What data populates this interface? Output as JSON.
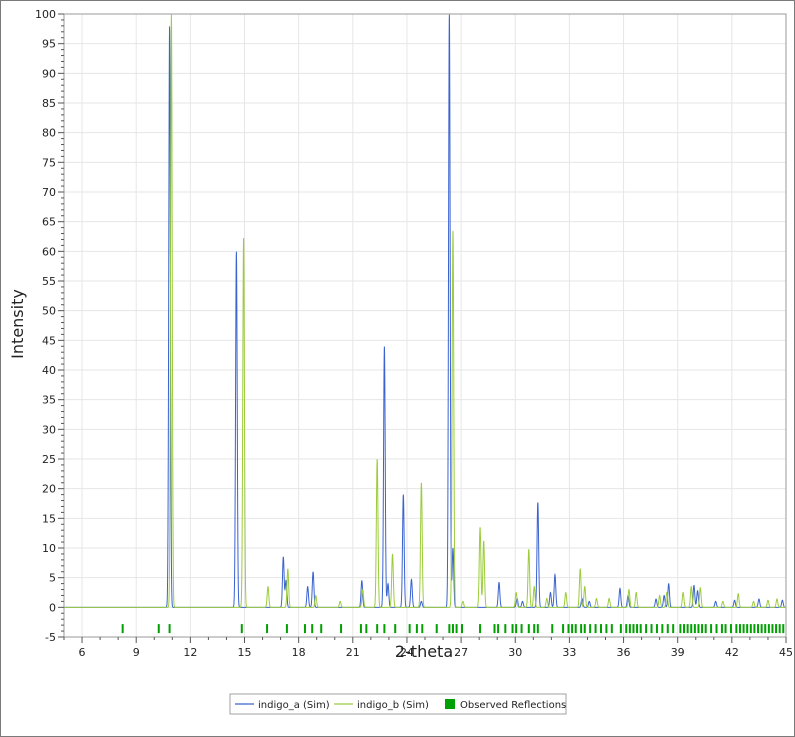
{
  "chart_data": {
    "type": "line",
    "xlabel": "2-theta",
    "ylabel": "Intensity",
    "xlim": [
      5,
      45
    ],
    "ylim": [
      -5,
      100
    ],
    "xticks": [
      6,
      9,
      12,
      15,
      18,
      21,
      24,
      27,
      30,
      33,
      36,
      39,
      42,
      45
    ],
    "yticks": [
      -5,
      0,
      5,
      10,
      15,
      20,
      25,
      30,
      35,
      40,
      45,
      50,
      55,
      60,
      65,
      70,
      75,
      80,
      85,
      90,
      95,
      100
    ],
    "grid": true,
    "legend_position": "bottom-center",
    "series": [
      {
        "name": "indigo_a (Sim)",
        "type": "line",
        "color": "#3a63d0",
        "peaks": [
          [
            10.85,
            98
          ],
          [
            14.55,
            60
          ],
          [
            17.15,
            8.5
          ],
          [
            17.3,
            4.5
          ],
          [
            18.5,
            3.5
          ],
          [
            18.8,
            6
          ],
          [
            21.5,
            4.5
          ],
          [
            22.75,
            44
          ],
          [
            22.95,
            4
          ],
          [
            23.8,
            19
          ],
          [
            24.25,
            4.7
          ],
          [
            24.8,
            1
          ],
          [
            26.35,
            100
          ],
          [
            26.55,
            10
          ],
          [
            29.1,
            4.2
          ],
          [
            30.1,
            1.5
          ],
          [
            30.4,
            1
          ],
          [
            31.25,
            17.7
          ],
          [
            31.95,
            2.5
          ],
          [
            32.2,
            5.5
          ],
          [
            33.7,
            1.5
          ],
          [
            34.1,
            1
          ],
          [
            35.8,
            3.2
          ],
          [
            36.25,
            2
          ],
          [
            37.8,
            1.4
          ],
          [
            38.25,
            2
          ],
          [
            38.5,
            4
          ],
          [
            39.9,
            3.7
          ],
          [
            40.1,
            2.8
          ],
          [
            41.1,
            1
          ],
          [
            42.15,
            1.2
          ],
          [
            43.5,
            1.4
          ],
          [
            44.8,
            1.2
          ]
        ]
      },
      {
        "name": "indigo_b (Sim)",
        "type": "line",
        "color": "#9ccc3c",
        "peaks": [
          [
            10.95,
            100
          ],
          [
            14.95,
            62.3
          ],
          [
            16.3,
            3.5
          ],
          [
            17.4,
            6.5
          ],
          [
            18.95,
            2
          ],
          [
            20.3,
            1
          ],
          [
            21.55,
            3
          ],
          [
            22.35,
            25
          ],
          [
            23.2,
            9
          ],
          [
            24.8,
            21
          ],
          [
            26.55,
            63.5
          ],
          [
            27.1,
            1
          ],
          [
            28.05,
            13.5
          ],
          [
            28.25,
            11.2
          ],
          [
            30.05,
            2.5
          ],
          [
            30.75,
            9.8
          ],
          [
            31.05,
            3.5
          ],
          [
            31.75,
            1.5
          ],
          [
            32.8,
            2.5
          ],
          [
            33.6,
            6.5
          ],
          [
            33.85,
            3.5
          ],
          [
            34.5,
            1.5
          ],
          [
            35.2,
            1.5
          ],
          [
            36.3,
            3
          ],
          [
            36.7,
            2.5
          ],
          [
            38.0,
            2
          ],
          [
            38.4,
            2.5
          ],
          [
            39.3,
            2.5
          ],
          [
            39.75,
            3.5
          ],
          [
            40.25,
            3.3
          ],
          [
            41.5,
            1
          ],
          [
            42.35,
            2.3
          ],
          [
            43.2,
            1
          ],
          [
            44.0,
            1.2
          ],
          [
            44.5,
            1.4
          ]
        ]
      },
      {
        "name": "Observed Reflections",
        "type": "ticks",
        "color": "#00a000",
        "y": -4,
        "x": [
          8.25,
          10.25,
          10.85,
          14.85,
          16.25,
          17.35,
          18.35,
          18.75,
          19.25,
          20.35,
          21.45,
          21.75,
          22.35,
          22.75,
          23.35,
          24.15,
          24.55,
          24.85,
          25.65,
          26.35,
          26.55,
          26.75,
          27.05,
          28.05,
          28.85,
          29.05,
          29.45,
          29.85,
          30.05,
          30.35,
          30.75,
          31.05,
          31.25,
          32.05,
          32.65,
          32.95,
          33.15,
          33.35,
          33.65,
          33.85,
          34.15,
          34.45,
          34.75,
          35.05,
          35.35,
          35.85,
          36.15,
          36.35,
          36.55,
          36.75,
          36.95,
          37.25,
          37.55,
          37.85,
          38.15,
          38.45,
          38.75,
          39.15,
          39.35,
          39.55,
          39.75,
          39.95,
          40.15,
          40.35,
          40.55,
          40.85,
          41.15,
          41.45,
          41.65,
          41.95,
          42.25,
          42.45,
          42.65,
          42.85,
          43.05,
          43.25,
          43.45,
          43.65,
          43.85,
          44.05,
          44.25,
          44.45,
          44.65,
          44.85
        ]
      }
    ]
  }
}
